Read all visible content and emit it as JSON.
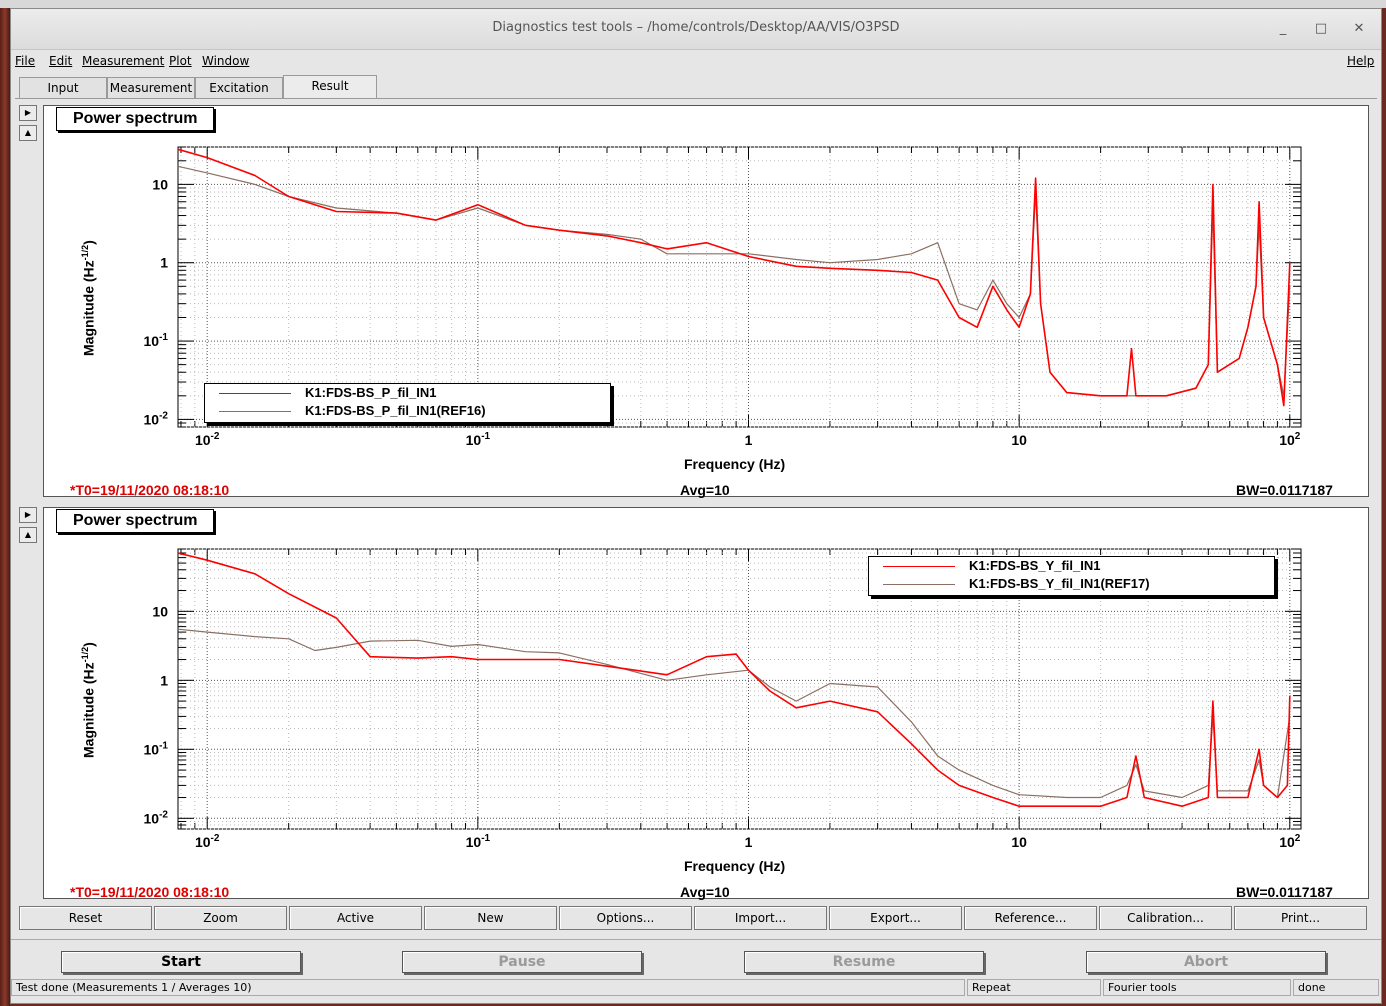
{
  "window": {
    "title": "Diagnostics test tools – /home/controls/Desktop/AA/VIS/O3PSD",
    "minimize_glyph": "_",
    "maximize_glyph": "□",
    "close_glyph": "✕"
  },
  "menubar": {
    "file": "File",
    "edit": "Edit",
    "measurement": "Measurement",
    "plot": "Plot",
    "window": "Window",
    "help": "Help"
  },
  "tabs": [
    "Input",
    "Measurement",
    "Excitation",
    "Result"
  ],
  "active_tab": "Result",
  "panels": [
    {
      "title": "Power spectrum",
      "ylabel": "Magnitude (Hz-1/2)",
      "xlabel": "Frequency (Hz)",
      "t0": "*T0=19/11/2020 08:18:10",
      "avg": "Avg=10",
      "bw": "BW=0.0117187",
      "legend": [
        "K1:FDS-BS_P_fil_IN1",
        "K1:FDS-BS_P_fil_IN1(REF16)"
      ]
    },
    {
      "title": "Power spectrum",
      "ylabel": "Magnitude (Hz-1/2)",
      "xlabel": "Frequency (Hz)",
      "t0": "*T0=19/11/2020 08:18:10",
      "avg": "Avg=10",
      "bw": "BW=0.0117187",
      "legend": [
        "K1:FDS-BS_Y_fil_IN1",
        "K1:FDS-BS_Y_fil_IN1(REF17)"
      ]
    }
  ],
  "plot_buttons": [
    "Reset",
    "Zoom",
    "Active",
    "New",
    "Options...",
    "Import...",
    "Export...",
    "Reference...",
    "Calibration...",
    "Print..."
  ],
  "control_buttons": {
    "start": "Start",
    "pause": "Pause",
    "resume": "Resume",
    "abort": "Abort"
  },
  "status": {
    "message": "Test done (Measurements 1 / Averages 10)",
    "repeat": "Repeat",
    "tools": "Fourier tools",
    "state": "done"
  },
  "colors": {
    "trace_live": "#ff0000",
    "trace_ref": "#8b6f63",
    "footer_text": "#e00000"
  },
  "chart_data": [
    {
      "type": "line",
      "title": "Power spectrum",
      "xlabel": "Frequency (Hz)",
      "ylabel": "Magnitude (Hz-1/2)",
      "x_scale": "log",
      "y_scale": "log",
      "xlim": [
        0.0078,
        110
      ],
      "ylim": [
        0.008,
        30
      ],
      "x_ticks": [
        {
          "value": 0.01,
          "label": "10-2"
        },
        {
          "value": 0.1,
          "label": "10-1"
        },
        {
          "value": 1,
          "label": "1"
        },
        {
          "value": 10,
          "label": "10"
        },
        {
          "value": 100,
          "label": "102"
        }
      ],
      "y_ticks": [
        {
          "value": 0.01,
          "label": "10-2"
        },
        {
          "value": 0.1,
          "label": "10-1"
        },
        {
          "value": 1,
          "label": "1"
        },
        {
          "value": 10,
          "label": "10"
        }
      ],
      "grid": true,
      "legend_position": "bottom-left",
      "series": [
        {
          "name": "K1:FDS-BS_P_fil_IN1",
          "color": "#ff0000",
          "points": [
            [
              0.0078,
              28
            ],
            [
              0.01,
              22
            ],
            [
              0.015,
              13
            ],
            [
              0.02,
              7
            ],
            [
              0.03,
              4.5
            ],
            [
              0.05,
              4.3
            ],
            [
              0.07,
              3.5
            ],
            [
              0.1,
              5.5
            ],
            [
              0.15,
              3
            ],
            [
              0.2,
              2.6
            ],
            [
              0.3,
              2.2
            ],
            [
              0.4,
              1.8
            ],
            [
              0.5,
              1.5
            ],
            [
              0.7,
              1.8
            ],
            [
              1,
              1.2
            ],
            [
              1.5,
              0.9
            ],
            [
              2,
              0.85
            ],
            [
              3,
              0.8
            ],
            [
              4,
              0.75
            ],
            [
              5,
              0.6
            ],
            [
              6,
              0.2
            ],
            [
              7,
              0.15
            ],
            [
              8,
              0.5
            ],
            [
              9,
              0.25
            ],
            [
              10,
              0.15
            ],
            [
              11,
              0.4
            ],
            [
              11.5,
              12
            ],
            [
              12,
              0.3
            ],
            [
              13,
              0.04
            ],
            [
              15,
              0.022
            ],
            [
              20,
              0.02
            ],
            [
              25,
              0.02
            ],
            [
              26,
              0.08
            ],
            [
              27,
              0.02
            ],
            [
              35,
              0.02
            ],
            [
              45,
              0.025
            ],
            [
              50,
              0.05
            ],
            [
              52,
              10
            ],
            [
              54,
              0.04
            ],
            [
              65,
              0.06
            ],
            [
              70,
              0.15
            ],
            [
              75,
              0.5
            ],
            [
              77,
              6
            ],
            [
              80,
              0.2
            ],
            [
              90,
              0.05
            ],
            [
              95,
              0.015
            ],
            [
              100,
              1.0
            ]
          ]
        },
        {
          "name": "K1:FDS-BS_P_fil_IN1(REF16)",
          "color": "#8b6f63",
          "points": [
            [
              0.0078,
              17
            ],
            [
              0.01,
              14
            ],
            [
              0.015,
              10
            ],
            [
              0.02,
              7
            ],
            [
              0.03,
              5
            ],
            [
              0.05,
              4.3
            ],
            [
              0.07,
              3.5
            ],
            [
              0.1,
              5
            ],
            [
              0.15,
              3
            ],
            [
              0.2,
              2.6
            ],
            [
              0.3,
              2.3
            ],
            [
              0.4,
              2
            ],
            [
              0.5,
              1.3
            ],
            [
              0.7,
              1.3
            ],
            [
              1,
              1.3
            ],
            [
              1.5,
              1.1
            ],
            [
              2,
              1.0
            ],
            [
              3,
              1.1
            ],
            [
              4,
              1.3
            ],
            [
              5,
              1.8
            ],
            [
              6,
              0.3
            ],
            [
              7,
              0.25
            ],
            [
              8,
              0.6
            ],
            [
              9,
              0.3
            ],
            [
              10,
              0.2
            ],
            [
              11,
              0.4
            ],
            [
              11.5,
              8
            ],
            [
              12,
              0.3
            ],
            [
              13,
              0.04
            ],
            [
              15,
              0.022
            ],
            [
              20,
              0.02
            ],
            [
              25,
              0.02
            ],
            [
              35,
              0.02
            ],
            [
              45,
              0.025
            ],
            [
              50,
              0.05
            ],
            [
              52,
              5
            ],
            [
              54,
              0.04
            ],
            [
              65,
              0.06
            ],
            [
              70,
              0.15
            ],
            [
              75,
              0.5
            ],
            [
              77,
              3
            ],
            [
              80,
              0.2
            ],
            [
              90,
              0.05
            ],
            [
              95,
              0.02
            ],
            [
              100,
              0.5
            ]
          ]
        }
      ]
    },
    {
      "type": "line",
      "title": "Power spectrum",
      "xlabel": "Frequency (Hz)",
      "ylabel": "Magnitude (Hz-1/2)",
      "x_scale": "log",
      "y_scale": "log",
      "xlim": [
        0.0078,
        110
      ],
      "ylim": [
        0.007,
        80
      ],
      "x_ticks": [
        {
          "value": 0.01,
          "label": "10-2"
        },
        {
          "value": 0.1,
          "label": "10-1"
        },
        {
          "value": 1,
          "label": "1"
        },
        {
          "value": 10,
          "label": "10"
        },
        {
          "value": 100,
          "label": "102"
        }
      ],
      "y_ticks": [
        {
          "value": 0.01,
          "label": "10-2"
        },
        {
          "value": 0.1,
          "label": "10-1"
        },
        {
          "value": 1,
          "label": "1"
        },
        {
          "value": 10,
          "label": "10"
        }
      ],
      "grid": true,
      "legend_position": "top-right",
      "series": [
        {
          "name": "K1:FDS-BS_Y_fil_IN1",
          "color": "#ff0000",
          "points": [
            [
              0.0078,
              70
            ],
            [
              0.01,
              55
            ],
            [
              0.015,
              35
            ],
            [
              0.02,
              18
            ],
            [
              0.03,
              8
            ],
            [
              0.04,
              2.2
            ],
            [
              0.06,
              2.1
            ],
            [
              0.08,
              2.2
            ],
            [
              0.1,
              2
            ],
            [
              0.15,
              2.0
            ],
            [
              0.2,
              2.0
            ],
            [
              0.3,
              1.6
            ],
            [
              0.5,
              1.2
            ],
            [
              0.7,
              2.2
            ],
            [
              0.9,
              2.4
            ],
            [
              1,
              1.4
            ],
            [
              1.2,
              0.7
            ],
            [
              1.5,
              0.4
            ],
            [
              2,
              0.5
            ],
            [
              3,
              0.35
            ],
            [
              4,
              0.12
            ],
            [
              5,
              0.05
            ],
            [
              6,
              0.03
            ],
            [
              8,
              0.02
            ],
            [
              10,
              0.015
            ],
            [
              15,
              0.015
            ],
            [
              20,
              0.015
            ],
            [
              25,
              0.02
            ],
            [
              27,
              0.08
            ],
            [
              29,
              0.02
            ],
            [
              40,
              0.015
            ],
            [
              50,
              0.02
            ],
            [
              52,
              0.5
            ],
            [
              54,
              0.02
            ],
            [
              70,
              0.02
            ],
            [
              77,
              0.1
            ],
            [
              80,
              0.03
            ],
            [
              90,
              0.02
            ],
            [
              98,
              0.03
            ],
            [
              100,
              0.6
            ]
          ]
        },
        {
          "name": "K1:FDS-BS_Y_fil_IN1(REF17)",
          "color": "#8b6f63",
          "points": [
            [
              0.0078,
              5.5
            ],
            [
              0.01,
              5
            ],
            [
              0.015,
              4.3
            ],
            [
              0.02,
              4
            ],
            [
              0.025,
              2.7
            ],
            [
              0.03,
              3
            ],
            [
              0.04,
              3.7
            ],
            [
              0.06,
              3.8
            ],
            [
              0.08,
              3.1
            ],
            [
              0.1,
              3.3
            ],
            [
              0.15,
              2.6
            ],
            [
              0.2,
              2.5
            ],
            [
              0.3,
              1.7
            ],
            [
              0.5,
              1.0
            ],
            [
              0.7,
              1.2
            ],
            [
              1,
              1.4
            ],
            [
              1.2,
              0.8
            ],
            [
              1.5,
              0.5
            ],
            [
              2,
              0.9
            ],
            [
              3,
              0.8
            ],
            [
              4,
              0.25
            ],
            [
              5,
              0.08
            ],
            [
              6,
              0.05
            ],
            [
              8,
              0.03
            ],
            [
              10,
              0.022
            ],
            [
              15,
              0.02
            ],
            [
              20,
              0.02
            ],
            [
              25,
              0.03
            ],
            [
              27,
              0.06
            ],
            [
              29,
              0.025
            ],
            [
              40,
              0.02
            ],
            [
              50,
              0.03
            ],
            [
              52,
              0.3
            ],
            [
              54,
              0.025
            ],
            [
              70,
              0.025
            ],
            [
              77,
              0.07
            ],
            [
              80,
              0.03
            ],
            [
              90,
              0.02
            ],
            [
              100,
              0.3
            ]
          ]
        }
      ]
    }
  ]
}
